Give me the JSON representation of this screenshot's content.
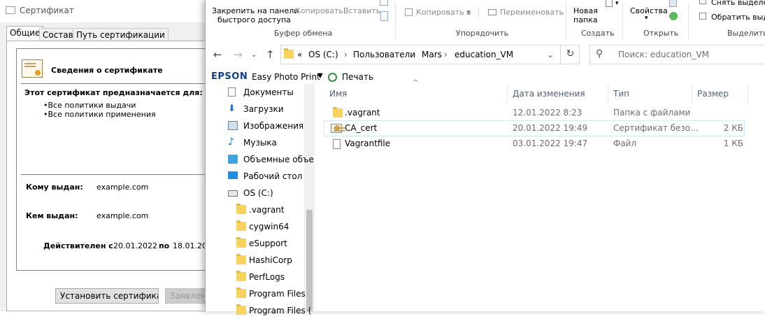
{
  "cert_dialog": {
    "title": "Сертификат",
    "tabs": [
      "Общие",
      "Состав",
      "Путь сертификации"
    ],
    "info_heading": "Сведения о сертификате",
    "purpose_heading": "Этот сертификат предназначается для:",
    "purposes": [
      "•Все политики выдачи",
      "•Все политики применения"
    ],
    "issued_to_label": "Кому выдан:",
    "issued_to_value": "example.com",
    "issued_by_label": "Кем выдан:",
    "issued_by_value": "example.com",
    "valid_label": "Действителен с",
    "valid_from": "20.01.2022",
    "valid_to_label": "по",
    "valid_to": "18.01.20",
    "install_button": "Установить сертификат...",
    "statement_button": "Заявлени"
  },
  "explorer": {
    "ribbon": {
      "pin_label_1": "Закрепить на панели",
      "pin_label_2": "быстрого доступа",
      "copy": "Копировать",
      "paste": "Вставить",
      "clipboard_group": "Буфер обмена",
      "copy_to": "Копировать в",
      "rename": "Переименовать",
      "organize_group": "Упорядочить",
      "new_folder_1": "Новая",
      "new_folder_2": "папка",
      "create_group": "Создать",
      "properties": "Свойства",
      "open_group": "Открыть",
      "deselect": "Снять выделен",
      "invert_select": "Обратить выде",
      "select_group": "Выделить"
    },
    "address": {
      "crumbs": [
        "OS (C:)",
        "Пользователи",
        "Mars",
        "education_VM"
      ],
      "overflow": "«",
      "search_placeholder": "Поиск: education_VM"
    },
    "epson_bar": {
      "brand": "EPSON",
      "app": "Easy Photo Print",
      "print": "Печать"
    },
    "nav_items": [
      {
        "label": "Документы",
        "icon": "documents-icon"
      },
      {
        "label": "Загрузки",
        "icon": "downloads-icon"
      },
      {
        "label": "Изображения",
        "icon": "pictures-icon"
      },
      {
        "label": "Музыка",
        "icon": "music-icon"
      },
      {
        "label": "Объемные объе",
        "icon": "3d-objects-icon"
      },
      {
        "label": "Рабочий стол",
        "icon": "desktop-icon"
      },
      {
        "label": "OS (C:)",
        "icon": "drive-icon"
      },
      {
        "label": ".vagrant",
        "icon": "folder-icon"
      },
      {
        "label": "cygwin64",
        "icon": "folder-icon"
      },
      {
        "label": "eSupport",
        "icon": "folder-icon"
      },
      {
        "label": "HashiCorp",
        "icon": "folder-icon"
      },
      {
        "label": "PerfLogs",
        "icon": "folder-icon"
      },
      {
        "label": "Program Files",
        "icon": "folder-icon"
      },
      {
        "label": "Program Files (",
        "icon": "folder-icon"
      }
    ],
    "columns": [
      "Имя",
      "Дата изменения",
      "Тип",
      "Размер"
    ],
    "files": [
      {
        "name": ".vagrant",
        "date": "12.01.2022 8:23",
        "type": "Папка с файлами",
        "size": "",
        "icon": "folder-icon"
      },
      {
        "name": "CA_cert",
        "date": "20.01.2022 19:49",
        "type": "Сертификат безо...",
        "size": "2 КБ",
        "icon": "certificate-icon"
      },
      {
        "name": "Vagrantfile",
        "date": "03.01.2022 19:47",
        "type": "Файл",
        "size": "1 КБ",
        "icon": "file-icon"
      }
    ]
  }
}
